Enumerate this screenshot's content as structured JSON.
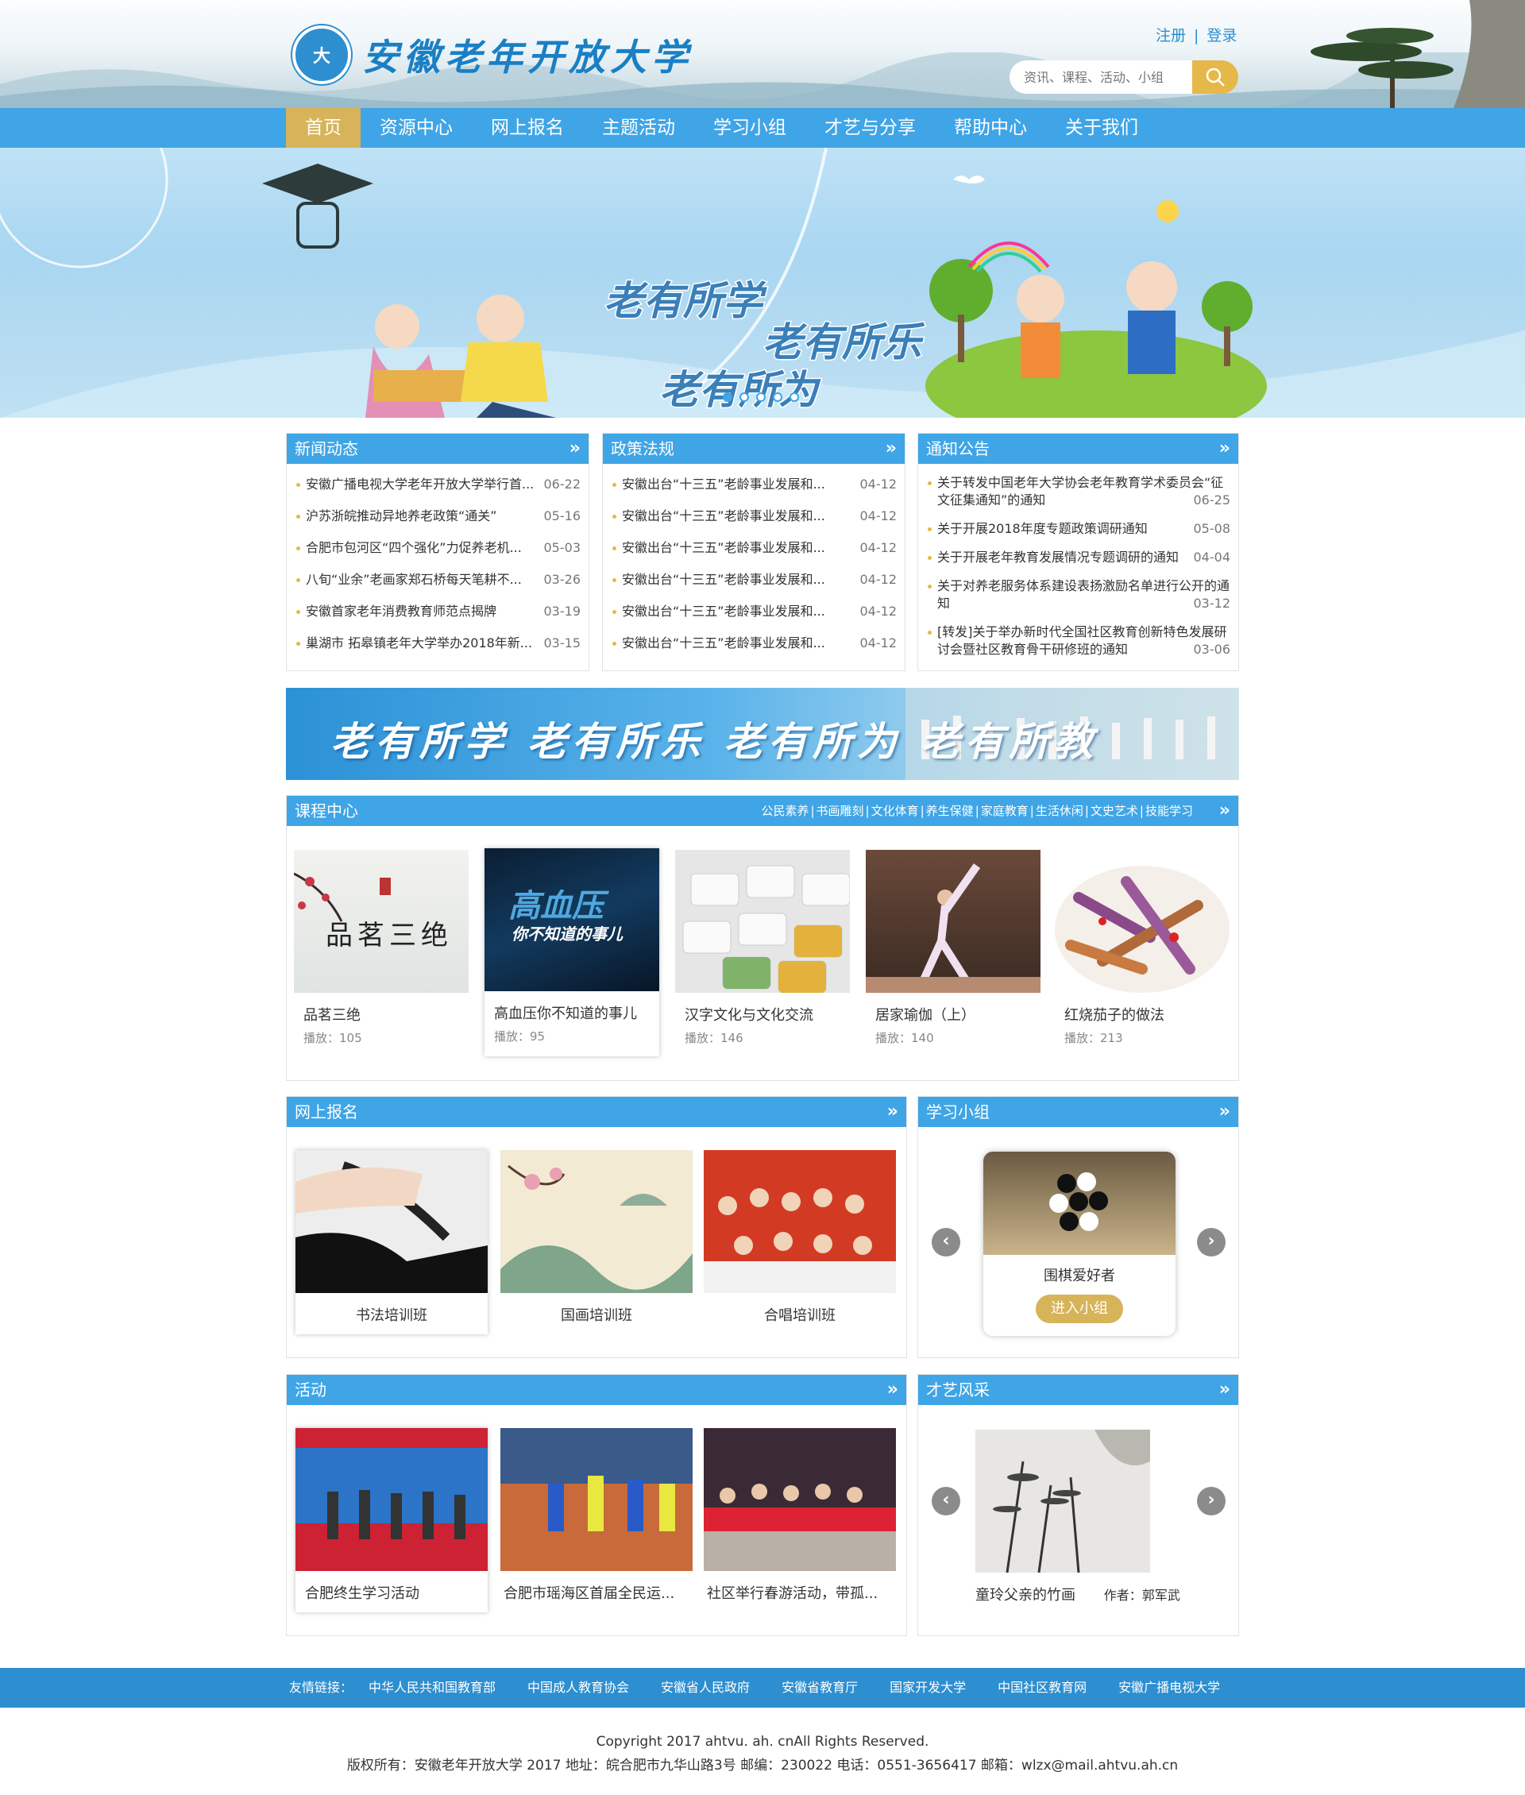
{
  "header": {
    "site_name": "安徽老年开放大学",
    "register": "注册",
    "separator": "|",
    "login": "登录",
    "search_placeholder": "资讯、课程、活动、小组"
  },
  "nav": [
    "首页",
    "资源中心",
    "网上报名",
    "主题活动",
    "学习小组",
    "才艺与分享",
    "帮助中心",
    "关于我们"
  ],
  "banner": {
    "slogans": [
      "老有所学",
      "老有所乐",
      "老有所为"
    ],
    "slides": 5,
    "active_slide": 1
  },
  "news": {
    "title": "新闻动态",
    "more": "»",
    "items": [
      {
        "t": "安徽广播电视大学老年开放大学举行首...",
        "d": "06-22"
      },
      {
        "t": "沪苏浙皖推动异地养老政策“通关”",
        "d": "05-16"
      },
      {
        "t": "合肥市包河区“四个强化”力促养老机...",
        "d": "05-03"
      },
      {
        "t": "八旬“业余”老画家郑石桥每天笔耕不...",
        "d": "03-26"
      },
      {
        "t": "安徽首家老年消费教育师范点揭牌",
        "d": "03-19"
      },
      {
        "t": "巢湖市 拓皋镇老年大学举办2018年新...",
        "d": "03-15"
      }
    ]
  },
  "policy": {
    "title": "政策法规",
    "more": "»",
    "items": [
      {
        "t": "安徽出台“十三五”老龄事业发展和...",
        "d": "04-12"
      },
      {
        "t": "安徽出台“十三五”老龄事业发展和...",
        "d": "04-12"
      },
      {
        "t": "安徽出台“十三五”老龄事业发展和...",
        "d": "04-12"
      },
      {
        "t": "安徽出台“十三五”老龄事业发展和...",
        "d": "04-12"
      },
      {
        "t": "安徽出台“十三五”老龄事业发展和...",
        "d": "04-12"
      },
      {
        "t": "安徽出台“十三五”老龄事业发展和...",
        "d": "04-12"
      }
    ]
  },
  "notice": {
    "title": "通知公告",
    "more": "»",
    "items": [
      {
        "t": "关于转发中国老年大学协会老年教育学术委员会“征文征集通知”的通知",
        "d": "06-25"
      },
      {
        "t": "关于开展2018年度专题政策调研通知",
        "d": "05-08"
      },
      {
        "t": "关于开展老年教育发展情况专题调研的通知",
        "d": "04-04"
      },
      {
        "t": "关于对养老服务体系建设表扬激励名单进行公开的通知",
        "d": "03-12"
      },
      {
        "t": "[转发]关于举办新时代全国社区教育创新特色发展研讨会暨社区教育骨干研修班的通知",
        "d": "03-06"
      }
    ]
  },
  "slogan_bar": "老有所学 老有所乐 老有所为 老有所教",
  "courses": {
    "title": "课程中心",
    "more": "»",
    "categories": [
      "公民素养",
      "书画雕刻",
      "文化体育",
      "养生保健",
      "家庭教育",
      "生活休闲",
      "文史艺术",
      "技能学习"
    ],
    "cat_sep": "|",
    "items": [
      {
        "title": "品茗三绝",
        "plays": "播放：105",
        "poster_text": "品茗三绝"
      },
      {
        "title": "高血压你不知道的事儿",
        "plays": "播放：95",
        "poster_text": "高血压",
        "poster_sub": "你不知道的事儿"
      },
      {
        "title": "汉字文化与文化交流",
        "plays": "播放：146"
      },
      {
        "title": "居家瑜伽（上）",
        "plays": "播放：140"
      },
      {
        "title": "红烧茄子的做法",
        "plays": "播放：213"
      }
    ]
  },
  "registration": {
    "title": "网上报名",
    "more": "»",
    "items": [
      "书法培训班",
      "国画培训班",
      "合唱培训班"
    ]
  },
  "groups": {
    "title": "学习小组",
    "more": "»",
    "name": "围棋爱好者",
    "join": "进入小组",
    "prev": "‹",
    "next": "›"
  },
  "activities": {
    "title": "活动",
    "more": "»",
    "items": [
      "合肥终生学习活动",
      "合肥市瑶海区首届全民运...",
      "社区举行春游活动，带孤..."
    ]
  },
  "talent": {
    "title": "才艺风采",
    "more": "»",
    "work": "童玲父亲的竹画",
    "author_label": "作者：",
    "author": "郭军武",
    "prev": "‹",
    "next": "›"
  },
  "footer": {
    "links_label": "友情链接：",
    "links": [
      "中华人民共和国教育部",
      "中国成人教育协会",
      "安徽省人民政府",
      "安徽省教育厅",
      "国家开发大学",
      "中国社区教育网",
      "安徽广播电视大学"
    ],
    "copyright": "Copyright 2017 ahtvu. ah. cnAll Rights Reserved.",
    "info": "版权所有：安徽老年开放大学 2017 地址：皖合肥市九华山路3号 邮编：230022 电话：0551-3656417 邮箱：wlzx@mail.ahtvu.ah.cn"
  },
  "colors": {
    "primary": "#3fa5e6",
    "accent": "#d7b35a",
    "footer": "#2d8ed0"
  }
}
